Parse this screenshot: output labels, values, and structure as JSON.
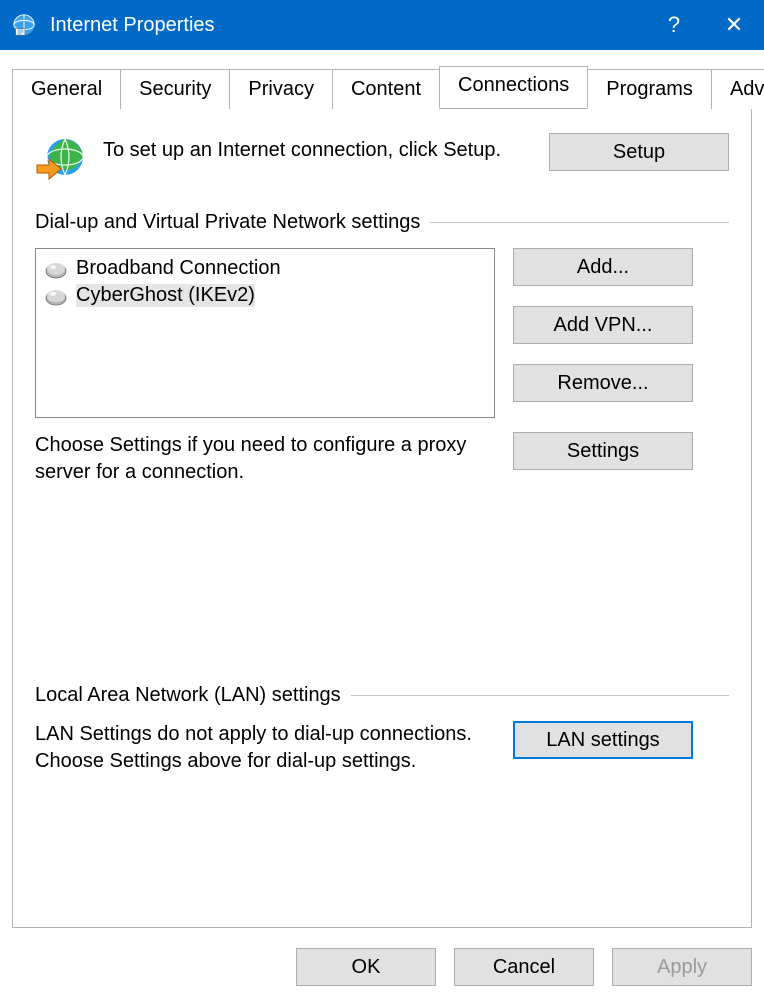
{
  "titlebar": {
    "title": "Internet Properties",
    "help": "?",
    "close": "✕"
  },
  "tabs": [
    {
      "label": "General"
    },
    {
      "label": "Security"
    },
    {
      "label": "Privacy"
    },
    {
      "label": "Content"
    },
    {
      "label": "Connections"
    },
    {
      "label": "Programs"
    },
    {
      "label": "Advanced"
    }
  ],
  "activeTab": 4,
  "content": {
    "setup_text": "To set up an Internet connection, click Setup.",
    "setup_btn": "Setup",
    "dialup_header": "Dial-up and Virtual Private Network settings",
    "connections": [
      {
        "label": "Broadband Connection",
        "selected": false
      },
      {
        "label": "CyberGhost (IKEv2)",
        "selected": true
      }
    ],
    "add_btn": "Add...",
    "addvpn_btn": "Add VPN...",
    "remove_btn": "Remove...",
    "settings_text": "Choose Settings if you need to configure a proxy server for a connection.",
    "settings_btn": "Settings",
    "lan_header": "Local Area Network (LAN) settings",
    "lan_text": "LAN Settings do not apply to dial-up connections. Choose Settings above for dial-up settings.",
    "lan_btn": "LAN settings"
  },
  "footer": {
    "ok": "OK",
    "cancel": "Cancel",
    "apply": "Apply"
  }
}
